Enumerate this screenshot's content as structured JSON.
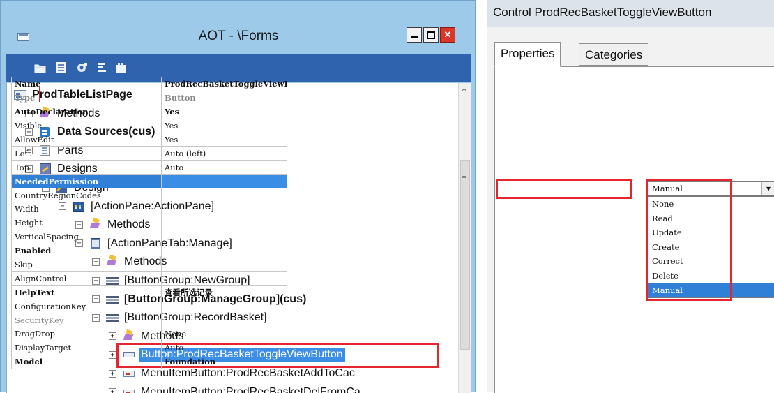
{
  "aot": {
    "title": "AOT - \\Forms",
    "tree": [
      {
        "label": "ProdTableListPage",
        "indent": 0,
        "expander": "",
        "icon": "form-icon",
        "bold": true
      },
      {
        "label": "Methods",
        "indent": 0,
        "expander": "+",
        "icon": "methods-icon",
        "bold": false
      },
      {
        "label": "Data Sources(cus)",
        "indent": 0,
        "expander": "+",
        "icon": "datasources-icon",
        "bold": true
      },
      {
        "label": "Parts",
        "indent": 0,
        "expander": "+",
        "icon": "parts-icon",
        "bold": false
      },
      {
        "label": "Designs",
        "indent": 0,
        "expander": "−",
        "icon": "designs-icon",
        "bold": false
      },
      {
        "label": "Design",
        "indent": 1,
        "expander": "−",
        "icon": "design-icon",
        "bold": false
      },
      {
        "label": "[ActionPane:ActionPane]",
        "indent": 2,
        "expander": "−",
        "icon": "actionpane-icon",
        "bold": false
      },
      {
        "label": "Methods",
        "indent": 3,
        "expander": "+",
        "icon": "methods-icon",
        "bold": false
      },
      {
        "label": "[ActionPaneTab:Manage]",
        "indent": 3,
        "expander": "−",
        "icon": "actionpanetab-icon",
        "bold": false
      },
      {
        "label": "Methods",
        "indent": 4,
        "expander": "+",
        "icon": "methods-icon",
        "bold": false
      },
      {
        "label": "[ButtonGroup:NewGroup]",
        "indent": 4,
        "expander": "+",
        "icon": "buttongroup-icon",
        "bold": false
      },
      {
        "label": "[ButtonGroup:ManageGroup](cus)",
        "indent": 4,
        "expander": "+",
        "icon": "buttongroup-icon",
        "bold": true
      },
      {
        "label": "[ButtonGroup:RecordBasket]",
        "indent": 4,
        "expander": "−",
        "icon": "buttongroup-icon",
        "bold": false
      },
      {
        "label": "Methods",
        "indent": 5,
        "expander": "+",
        "icon": "methods-icon",
        "bold": false
      },
      {
        "label": "Button:ProdRecBasketToggleViewButton",
        "indent": 5,
        "expander": "+",
        "icon": "button-icon",
        "bold": false,
        "selected": true
      },
      {
        "label": "MenuItemButton:ProdRecBasketAddToCac",
        "indent": 5,
        "expander": "+",
        "icon": "menuitembutton-icon",
        "bold": false
      },
      {
        "label": "MenuItemButton:ProdRecBasketDelFromCa",
        "indent": 5,
        "expander": "+",
        "icon": "menuitembutton-icon",
        "bold": false
      }
    ]
  },
  "props": {
    "title": "Control ProdRecBasketToggleViewButton",
    "tabs": [
      "Properties",
      "Categories"
    ],
    "rows": [
      {
        "name": "Name",
        "value": "ProdRecBasketToggleViewButton",
        "style": "b"
      },
      {
        "name": "Type",
        "value": "Button",
        "style": "bg"
      },
      {
        "name": "AutoDeclaration",
        "value": "Yes",
        "style": "b"
      },
      {
        "name": "Visible",
        "value": "Yes",
        "style": ""
      },
      {
        "name": "AllowEdit",
        "value": "Yes",
        "style": ""
      },
      {
        "name": "Left",
        "value": "Auto (left)",
        "style": ""
      },
      {
        "name": "Top",
        "value": "Auto",
        "style": ""
      },
      {
        "name": "NeededPermission",
        "value": "",
        "style": "b sel"
      },
      {
        "name": "CountryRegionCodes",
        "value": "",
        "style": ""
      },
      {
        "name": "Width",
        "value": "",
        "style": ""
      },
      {
        "name": "Height",
        "value": "",
        "style": ""
      },
      {
        "name": "VerticalSpacing",
        "value": "",
        "style": ""
      },
      {
        "name": "Enabled",
        "value": "",
        "style": "b"
      },
      {
        "name": "Skip",
        "value": "",
        "style": ""
      },
      {
        "name": "AlignControl",
        "value": "",
        "style": ""
      },
      {
        "name": "HelpText",
        "value": "查看所选记录",
        "style": "b"
      },
      {
        "name": "ConfigurationKey",
        "value": "",
        "style": ""
      },
      {
        "name": "SecurityKey",
        "value": "",
        "style": "g"
      },
      {
        "name": "DragDrop",
        "value": "None",
        "style": ""
      },
      {
        "name": "DisplayTarget",
        "value": "Auto",
        "style": ""
      },
      {
        "name": "Model",
        "value": "Foundation",
        "style": "b"
      }
    ],
    "needed_permission": {
      "selected": "Manual",
      "options": [
        "None",
        "Read",
        "Update",
        "Create",
        "Correct",
        "Delete",
        "Manual"
      ]
    }
  }
}
